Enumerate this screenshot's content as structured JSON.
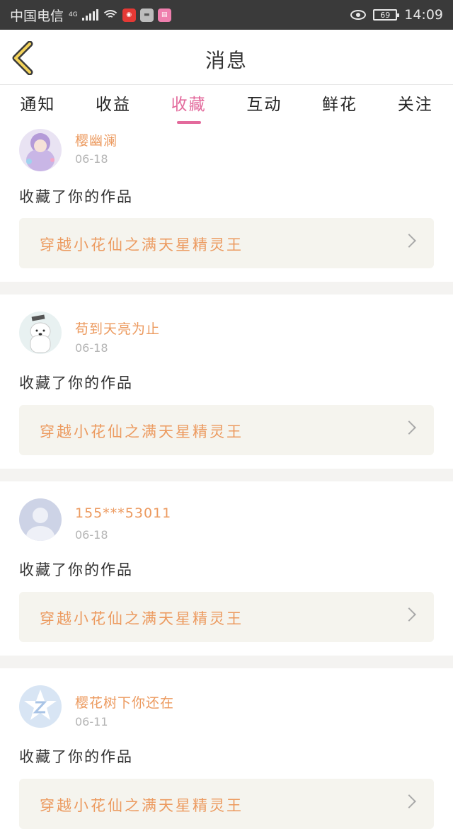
{
  "status_bar": {
    "carrier": "中国电信",
    "network": "4G",
    "battery": "69",
    "time": "14:09"
  },
  "header": {
    "title": "消息"
  },
  "tabs": [
    {
      "label": "通知"
    },
    {
      "label": "收益"
    },
    {
      "label": "收藏",
      "active": true
    },
    {
      "label": "互动"
    },
    {
      "label": "鲜花"
    },
    {
      "label": "关注"
    }
  ],
  "items": [
    {
      "user": "樱幽澜",
      "date": "06-18",
      "action": "收藏了你的作品",
      "work": "穿越小花仙之满天星精灵王"
    },
    {
      "user": "苟到天亮为止",
      "date": "06-18",
      "action": "收藏了你的作品",
      "work": "穿越小花仙之满天星精灵王"
    },
    {
      "user": "155***53011",
      "date": "06-18",
      "action": "收藏了你的作品",
      "work": "穿越小花仙之满天星精灵王"
    },
    {
      "user": "樱花树下你还在",
      "date": "06-11",
      "action": "收藏了你的作品",
      "work": "穿越小花仙之满天星精灵王"
    }
  ],
  "colors": {
    "accent": "#e36a9c",
    "username": "#ec9a5f",
    "work_bg": "#f5f4ee",
    "status_bar": "#3a3a3a"
  }
}
